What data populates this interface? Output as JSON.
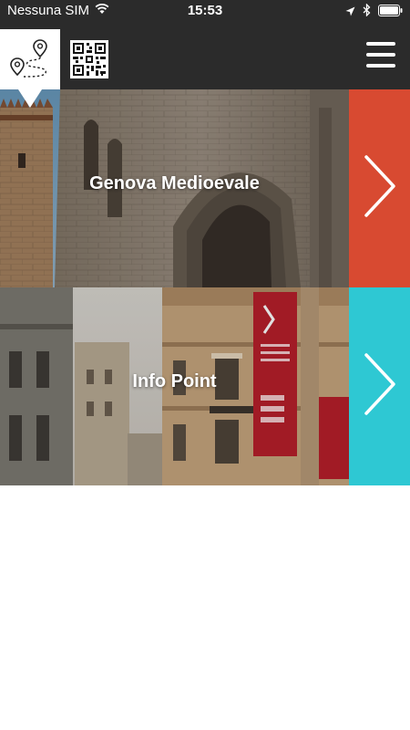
{
  "status_bar": {
    "carrier": "Nessuna SIM",
    "time": "15:53"
  },
  "header": {
    "icons": {
      "route": "route-map-icon",
      "qr": "qr-code-icon",
      "menu": "hamburger-menu-icon"
    }
  },
  "cards": [
    {
      "title": "Genova Medioevale",
      "accent_color": "#d84a31",
      "arrow_icon": "chevron-right-icon"
    },
    {
      "title": "Info Point",
      "accent_color": "#2ec8d3",
      "arrow_icon": "chevron-right-icon"
    }
  ],
  "colors": {
    "header_bg": "#2b2b2b",
    "page_bg": "#ffffff"
  }
}
